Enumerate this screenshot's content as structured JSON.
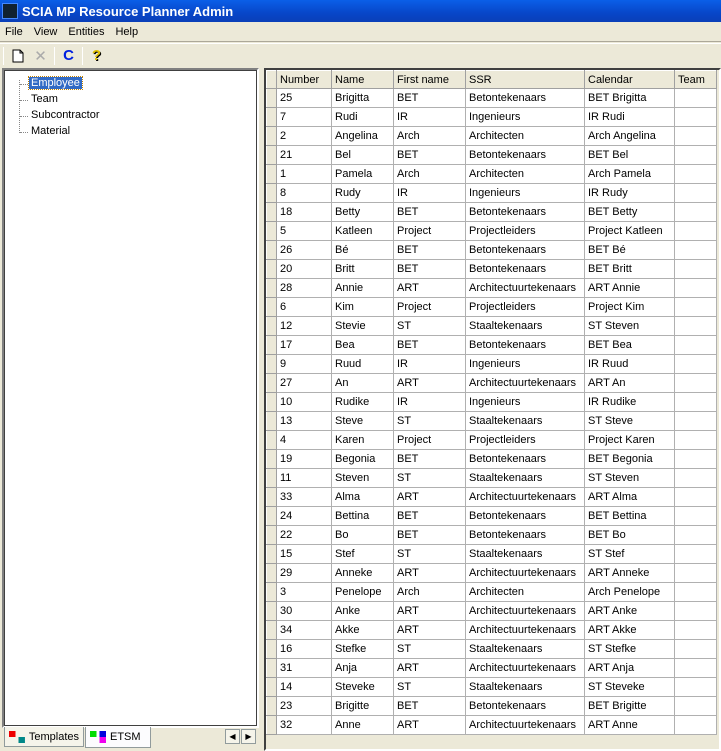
{
  "window": {
    "title": "SCIA MP Resource Planner Admin"
  },
  "menu": [
    "File",
    "View",
    "Entities",
    "Help"
  ],
  "toolbar": {
    "icons": [
      "new-document-icon",
      "delete-icon",
      "refresh-icon",
      "help-icon"
    ]
  },
  "tree": {
    "items": [
      "Employee",
      "Team",
      "Subcontractor",
      "Material"
    ],
    "selected": "Employee"
  },
  "tabs": [
    {
      "label": "Templates"
    },
    {
      "label": "ETSM",
      "active": true
    }
  ],
  "grid": {
    "columns": [
      "Number",
      "Name",
      "First name",
      "SSR",
      "Calendar",
      "Team"
    ],
    "rows": [
      [
        "25",
        "Brigitta",
        "BET",
        "Betontekenaars",
        "BET Brigitta",
        ""
      ],
      [
        "7",
        "Rudi",
        "IR",
        "Ingenieurs",
        "IR Rudi",
        ""
      ],
      [
        "2",
        "Angelina",
        "Arch",
        "Architecten",
        "Arch Angelina",
        ""
      ],
      [
        "21",
        "Bel",
        "BET",
        "Betontekenaars",
        "BET Bel",
        ""
      ],
      [
        "1",
        "Pamela",
        "Arch",
        "Architecten",
        "Arch Pamela",
        ""
      ],
      [
        "8",
        "Rudy",
        "IR",
        "Ingenieurs",
        "IR Rudy",
        ""
      ],
      [
        "18",
        "Betty",
        "BET",
        "Betontekenaars",
        "BET Betty",
        ""
      ],
      [
        "5",
        "Katleen",
        "Project",
        "Projectleiders",
        "Project Katleen",
        ""
      ],
      [
        "26",
        "Bé",
        "BET",
        "Betontekenaars",
        "BET Bé",
        ""
      ],
      [
        "20",
        "Britt",
        "BET",
        "Betontekenaars",
        "BET Britt",
        ""
      ],
      [
        "28",
        "Annie",
        "ART",
        "Architectuurtekenaars",
        "ART Annie",
        ""
      ],
      [
        "6",
        "Kim",
        "Project",
        "Projectleiders",
        "Project Kim",
        ""
      ],
      [
        "12",
        "Stevie",
        "ST",
        "Staaltekenaars",
        "ST Steven",
        ""
      ],
      [
        "17",
        "Bea",
        "BET",
        "Betontekenaars",
        "BET Bea",
        ""
      ],
      [
        "9",
        "Ruud",
        "IR",
        "Ingenieurs",
        "IR Ruud",
        ""
      ],
      [
        "27",
        "An",
        "ART",
        "Architectuurtekenaars",
        "ART An",
        ""
      ],
      [
        "10",
        "Rudike",
        "IR",
        "Ingenieurs",
        "IR Rudike",
        ""
      ],
      [
        "13",
        "Steve",
        "ST",
        "Staaltekenaars",
        "ST Steve",
        ""
      ],
      [
        "4",
        "Karen",
        "Project",
        "Projectleiders",
        "Project Karen",
        ""
      ],
      [
        "19",
        "Begonia",
        "BET",
        "Betontekenaars",
        "BET Begonia",
        ""
      ],
      [
        "11",
        "Steven",
        "ST",
        "Staaltekenaars",
        "ST Steven",
        ""
      ],
      [
        "33",
        "Alma",
        "ART",
        "Architectuurtekenaars",
        "ART Alma",
        ""
      ],
      [
        "24",
        "Bettina",
        "BET",
        "Betontekenaars",
        "BET Bettina",
        ""
      ],
      [
        "22",
        "Bo",
        "BET",
        "Betontekenaars",
        "BET Bo",
        ""
      ],
      [
        "15",
        "Stef",
        "ST",
        "Staaltekenaars",
        "ST Stef",
        ""
      ],
      [
        "29",
        "Anneke",
        "ART",
        "Architectuurtekenaars",
        "ART Anneke",
        ""
      ],
      [
        "3",
        "Penelope",
        "Arch",
        "Architecten",
        "Arch Penelope",
        ""
      ],
      [
        "30",
        "Anke",
        "ART",
        "Architectuurtekenaars",
        "ART Anke",
        ""
      ],
      [
        "34",
        "Akke",
        "ART",
        "Architectuurtekenaars",
        "ART Akke",
        ""
      ],
      [
        "16",
        "Stefke",
        "ST",
        "Staaltekenaars",
        "ST Stefke",
        ""
      ],
      [
        "31",
        "Anja",
        "ART",
        "Architectuurtekenaars",
        "ART Anja",
        ""
      ],
      [
        "14",
        "Steveke",
        "ST",
        "Staaltekenaars",
        "ST Steveke",
        ""
      ],
      [
        "23",
        "Brigitte",
        "BET",
        "Betontekenaars",
        "BET Brigitte",
        ""
      ],
      [
        "32",
        "Anne",
        "ART",
        "Architectuurtekenaars",
        "ART  Anne",
        ""
      ]
    ]
  }
}
